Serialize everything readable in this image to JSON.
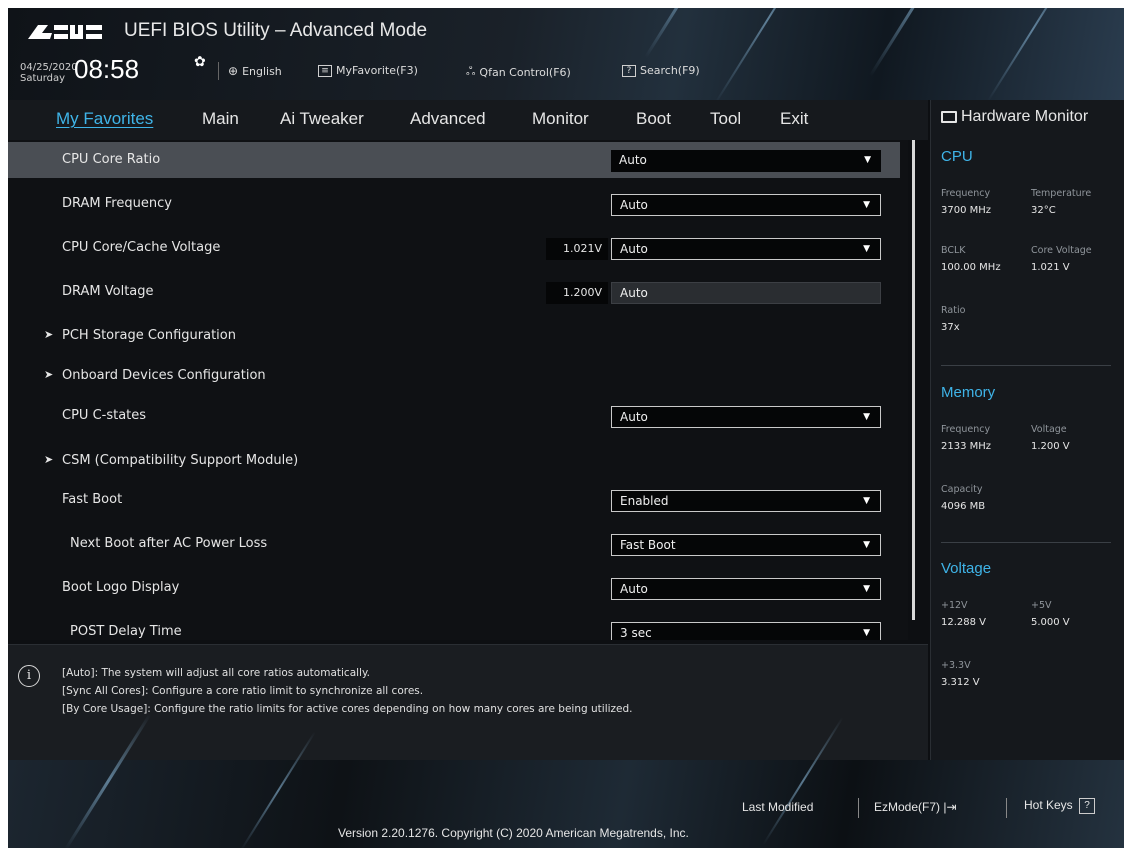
{
  "header": {
    "title": "UEFI BIOS Utility – Advanced Mode",
    "date": "04/25/2020",
    "day": "Saturday",
    "time": "08:58",
    "language": "English",
    "myfavorite": "MyFavorite(F3)",
    "qfan": "Qfan Control(F6)",
    "search": "Search(F9)"
  },
  "nav": {
    "tabs": [
      {
        "label": "My Favorites",
        "active": true
      },
      {
        "label": "Main"
      },
      {
        "label": "Ai Tweaker"
      },
      {
        "label": "Advanced"
      },
      {
        "label": "Monitor"
      },
      {
        "label": "Boot"
      },
      {
        "label": "Tool"
      },
      {
        "label": "Exit"
      }
    ]
  },
  "settings": [
    {
      "label": "CPU Core Ratio",
      "value": "Auto"
    },
    {
      "label": "DRAM Frequency",
      "value": "Auto"
    },
    {
      "label": "CPU Core/Cache Voltage",
      "reading": "1.021V",
      "value": "Auto"
    },
    {
      "label": "DRAM Voltage",
      "reading": "1.200V",
      "value": "Auto"
    },
    {
      "label": "PCH Storage Configuration"
    },
    {
      "label": "Onboard Devices Configuration"
    },
    {
      "label": "CPU C-states",
      "value": "Auto"
    },
    {
      "label": "CSM (Compatibility Support Module)"
    },
    {
      "label": "Fast Boot",
      "value": "Enabled"
    },
    {
      "label": "Next Boot after AC Power Loss",
      "value": "Fast Boot"
    },
    {
      "label": "Boot Logo Display",
      "value": "Auto"
    },
    {
      "label": "POST Delay Time",
      "value": "3 sec"
    }
  ],
  "help": [
    "[Auto]: The system will adjust all core ratios automatically.",
    "[Sync All Cores]: Configure a core ratio limit to synchronize all cores.",
    "[By Core Usage]: Configure the ratio limits for active cores depending on how many cores are being utilized."
  ],
  "hw": {
    "title": "Hardware Monitor",
    "cpu": {
      "section": "CPU",
      "frequency_label": "Frequency",
      "frequency": "3700 MHz",
      "temperature_label": "Temperature",
      "temperature": "32°C",
      "bclk_label": "BCLK",
      "bclk": "100.00 MHz",
      "core_voltage_label": "Core Voltage",
      "core_voltage": "1.021 V",
      "ratio_label": "Ratio",
      "ratio": "37x"
    },
    "memory": {
      "section": "Memory",
      "frequency_label": "Frequency",
      "frequency": "2133 MHz",
      "voltage_label": "Voltage",
      "voltage": "1.200 V",
      "capacity_label": "Capacity",
      "capacity": "4096 MB"
    },
    "voltage": {
      "section": "Voltage",
      "v12_label": "+12V",
      "v12": "12.288 V",
      "v5_label": "+5V",
      "v5": "5.000 V",
      "v33_label": "+3.3V",
      "v33": "3.312 V"
    }
  },
  "footer": {
    "last_modified": "Last Modified",
    "ezmode": "EzMode(F7)",
    "hotkeys": "Hot Keys",
    "hotkeys_key": "?",
    "version": "Version 2.20.1276. Copyright (C) 2020 American Megatrends, Inc."
  },
  "colors": {
    "accent": "#3fb4e8",
    "selected_row": "#4a4e54"
  }
}
